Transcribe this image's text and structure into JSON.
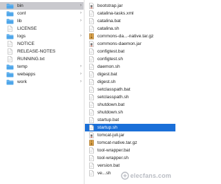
{
  "colors": {
    "folder": "#4ea6ea",
    "selection_inactive": "#c9c9ce",
    "selection_active": "#1a6fd8",
    "text": "#222222"
  },
  "left_column": {
    "items": [
      {
        "label": "bin",
        "kind": "folder",
        "icon": "folder-icon",
        "expandable": true,
        "selected": true
      },
      {
        "label": "conf",
        "kind": "folder",
        "icon": "folder-icon",
        "expandable": true,
        "selected": false
      },
      {
        "label": "lib",
        "kind": "folder",
        "icon": "folder-icon",
        "expandable": true,
        "selected": false
      },
      {
        "label": "LICENSE",
        "kind": "file",
        "icon": "document-icon",
        "expandable": false,
        "selected": false
      },
      {
        "label": "logs",
        "kind": "folder",
        "icon": "folder-icon",
        "expandable": true,
        "selected": false
      },
      {
        "label": "NOTICE",
        "kind": "file",
        "icon": "document-icon",
        "expandable": false,
        "selected": false
      },
      {
        "label": "RELEASE-NOTES",
        "kind": "file",
        "icon": "document-icon",
        "expandable": false,
        "selected": false
      },
      {
        "label": "RUNNING.txt",
        "kind": "file",
        "icon": "document-icon",
        "expandable": false,
        "selected": false
      },
      {
        "label": "temp",
        "kind": "folder",
        "icon": "folder-icon",
        "expandable": true,
        "selected": false
      },
      {
        "label": "webapps",
        "kind": "folder",
        "icon": "folder-icon",
        "expandable": true,
        "selected": false
      },
      {
        "label": "work",
        "kind": "folder",
        "icon": "folder-icon",
        "expandable": true,
        "selected": false
      }
    ]
  },
  "right_column": {
    "items": [
      {
        "label": "bootstrap.jar",
        "icon": "jar-icon"
      },
      {
        "label": "catalina-tasks.xml",
        "icon": "document-icon"
      },
      {
        "label": "catalina.bat",
        "icon": "document-icon"
      },
      {
        "label": "catalina.sh",
        "icon": "document-icon"
      },
      {
        "label": "commons-da...-native.tar.gz",
        "icon": "archive-icon"
      },
      {
        "label": "commons-daemon.jar",
        "icon": "jar-icon"
      },
      {
        "label": "configtest.bat",
        "icon": "document-icon"
      },
      {
        "label": "configtest.sh",
        "icon": "document-icon"
      },
      {
        "label": "daemon.sh",
        "icon": "document-icon"
      },
      {
        "label": "digest.bat",
        "icon": "document-icon"
      },
      {
        "label": "digest.sh",
        "icon": "document-icon"
      },
      {
        "label": "setclasspath.bat",
        "icon": "document-icon"
      },
      {
        "label": "setclasspath.sh",
        "icon": "document-icon"
      },
      {
        "label": "shutdown.bat",
        "icon": "document-icon"
      },
      {
        "label": "shutdown.sh",
        "icon": "document-icon"
      },
      {
        "label": "startup.bat",
        "icon": "document-icon"
      },
      {
        "label": "startup.sh",
        "icon": "document-icon",
        "selected": true
      },
      {
        "label": "tomcat-juli.jar",
        "icon": "jar-icon"
      },
      {
        "label": "tomcat-native.tar.gz",
        "icon": "archive-icon"
      },
      {
        "label": "tool-wrapper.bat",
        "icon": "document-icon"
      },
      {
        "label": "tool-wrapper.sh",
        "icon": "document-icon"
      },
      {
        "label": "version.bat",
        "icon": "document-icon"
      },
      {
        "label": "ve...sh",
        "icon": "document-icon"
      }
    ]
  },
  "watermark": {
    "text": "elecfans.com"
  }
}
